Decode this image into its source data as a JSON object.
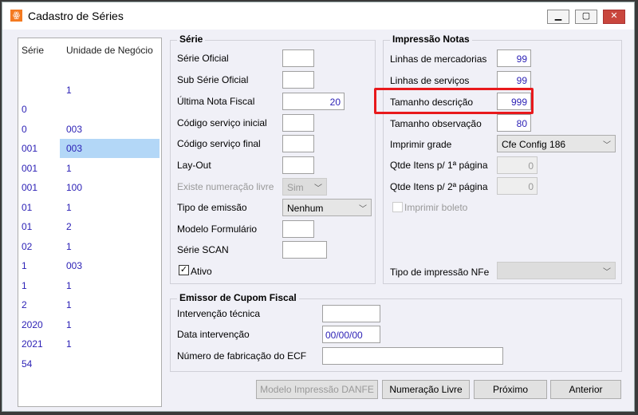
{
  "window": {
    "title": "Cadastro de Séries",
    "minimize": "▁",
    "maximize": "▢",
    "close": "✕"
  },
  "list": {
    "headers": [
      "Série",
      "Unidade de Negócio"
    ],
    "rows": [
      [
        "",
        ""
      ],
      [
        "",
        "1"
      ],
      [
        "0",
        ""
      ],
      [
        "0",
        "003"
      ],
      [
        "001",
        "003"
      ],
      [
        "001",
        "1"
      ],
      [
        "001",
        "100"
      ],
      [
        "01",
        "1"
      ],
      [
        "01",
        "2"
      ],
      [
        "02",
        "1"
      ],
      [
        "1",
        "003"
      ],
      [
        "1",
        "1"
      ],
      [
        "2",
        "1"
      ],
      [
        "2020",
        "1"
      ],
      [
        "2021",
        "1"
      ],
      [
        "54",
        ""
      ]
    ],
    "selected_index": 4
  },
  "serie": {
    "title": "Série",
    "serie_oficial": "Série Oficial",
    "sub_serie": "Sub Série Oficial",
    "ultima_nota": "Última Nota Fiscal",
    "ultima_nota_value": "20",
    "cod_inicial": "Código serviço inicial",
    "cod_final": "Código serviço final",
    "layout": "Lay-Out",
    "existe_num": "Existe numeração livre",
    "existe_num_value": "Sim",
    "tipo_emissao": "Tipo de emissão",
    "tipo_emissao_value": "Nenhum",
    "modelo": "Modelo Formulário",
    "serie_scan": "Série SCAN",
    "ativo": "Ativo",
    "ativo_checked": true
  },
  "impressao": {
    "title": "Impressão Notas",
    "linhas_merc": "Linhas de mercadorias",
    "linhas_merc_value": "99",
    "linhas_serv": "Linhas de serviços",
    "linhas_serv_value": "99",
    "tam_desc": "Tamanho descrição",
    "tam_desc_value": "999",
    "tam_obs": "Tamanho observação",
    "tam_obs_value": "80",
    "grade": "Imprimir grade",
    "grade_value": "Cfe Config 186",
    "qtde1": "Qtde Itens p/ 1ª página",
    "qtde1_value": "0",
    "qtde2": "Qtde Itens p/ 2ª página",
    "qtde2_value": "0",
    "boleto": "Imprimir boleto",
    "tipo_nfe": "Tipo de impressão NFe"
  },
  "cupom": {
    "title": "Emissor de Cupom Fiscal",
    "intervencao": "Intervenção técnica",
    "data": "Data intervenção",
    "data_value": "00/00/00",
    "numero": "Número de fabricação do ECF"
  },
  "buttons": {
    "modelo": "Modelo Impressão DANFE",
    "numeracao": "Numeração Livre",
    "proximo": "Próximo",
    "anterior": "Anterior"
  },
  "colors": {
    "highlight": "#e8191c",
    "value_text": "#2a1fb5",
    "selection": "#b3d7f7"
  }
}
